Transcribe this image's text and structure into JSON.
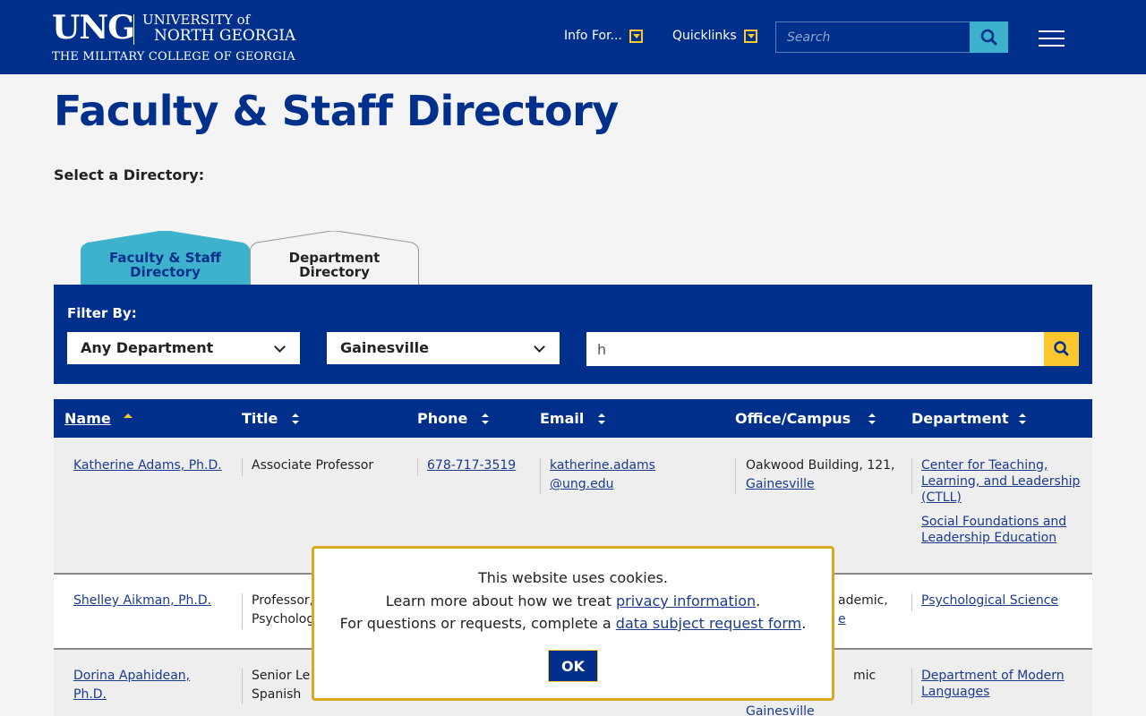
{
  "header": {
    "logo_ung": "UNG",
    "logo_university_of": "UNIVERSITY of",
    "logo_north_georgia": "NORTH GEORGIA",
    "logo_tagline": "THE MILITARY COLLEGE OF GEORGIA",
    "info_for": "Info For...",
    "quicklinks": "Quicklinks",
    "search_placeholder": "Search"
  },
  "page": {
    "title": "Faculty & Staff Directory",
    "select_label": "Select a Directory:"
  },
  "tabs": [
    {
      "line1": "Faculty & Staff",
      "line2": "Directory",
      "active": true
    },
    {
      "line1": "Department",
      "line2": "Directory",
      "active": false
    }
  ],
  "filter": {
    "label": "Filter By:",
    "department": "Any Department",
    "campus": "Gainesville",
    "text_value": "h"
  },
  "table": {
    "columns": [
      "Name",
      "Title",
      "Phone",
      "Email",
      "Office/Campus",
      "Department"
    ],
    "rows": [
      {
        "name": "Katherine Adams, Ph.D.",
        "title": "Associate Professor",
        "phone": "678-717-3519",
        "email_line1": "katherine.adams",
        "email_line2": "@ung.edu",
        "office_line1": "Oakwood Building, 121,",
        "office_campus": "Gainesville",
        "dept1_line1": "Center for Teaching,",
        "dept1_line2": "Learning, and Leadership",
        "dept1_line3": "(CTLL)",
        "dept2_line1": "Social Foundations and",
        "dept2_line2": "Leadership Education"
      },
      {
        "name": "Shelley Aikman, Ph.D.",
        "title_line1": "Professor,",
        "title_line2": "Psycholog",
        "office_line1": "ademic,",
        "office_line2": "e",
        "dept": "Psychological Science"
      },
      {
        "name_line1": "Dorina Apahidean,",
        "name_line2": "Ph.D.",
        "title_line1": "Senior Le",
        "title_line2": "Spanish",
        "office_line1": "mic",
        "office_campus": "Gainesville",
        "dept_line1": "Department of Modern",
        "dept_line2": "Languages"
      }
    ]
  },
  "cookie": {
    "line1": "This website uses cookies.",
    "line2_prefix": "Learn more about how we treat ",
    "line2_link": "privacy information",
    "line2_suffix": ".",
    "line3_prefix": "For questions or requests, complete a ",
    "line3_link": "data subject request form",
    "line3_suffix": ".",
    "ok_label": "OK"
  },
  "colors": {
    "brand_blue": "#00308b",
    "accent_gold": "#fdc82f",
    "tab_teal": "#3eb1cc"
  }
}
